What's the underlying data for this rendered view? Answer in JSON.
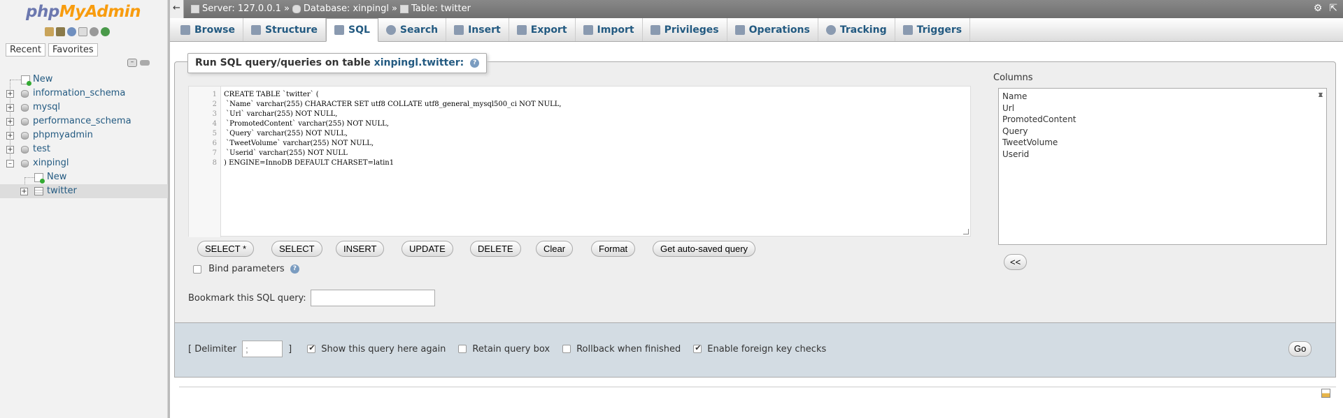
{
  "sidebar": {
    "logo": {
      "php": "php",
      "my": "My",
      "admin": "Admin"
    },
    "tabs": {
      "recent": "Recent",
      "favorites": "Favorites"
    },
    "tree": [
      {
        "label": "New",
        "type": "new"
      },
      {
        "label": "information_schema",
        "type": "db"
      },
      {
        "label": "mysql",
        "type": "db"
      },
      {
        "label": "performance_schema",
        "type": "db"
      },
      {
        "label": "phpmyadmin",
        "type": "db"
      },
      {
        "label": "test",
        "type": "db"
      },
      {
        "label": "xinpingl",
        "type": "db-open"
      }
    ],
    "children": [
      {
        "label": "New"
      },
      {
        "label": "twitter"
      }
    ]
  },
  "topbar": {
    "server": "Server: 127.0.0.1",
    "database": "Database: xinpingl",
    "table": "Table: twitter",
    "sep": "»"
  },
  "tabs": [
    {
      "label": "Browse"
    },
    {
      "label": "Structure"
    },
    {
      "label": "SQL"
    },
    {
      "label": "Search"
    },
    {
      "label": "Insert"
    },
    {
      "label": "Export"
    },
    {
      "label": "Import"
    },
    {
      "label": "Privileges"
    },
    {
      "label": "Operations"
    },
    {
      "label": "Tracking"
    },
    {
      "label": "Triggers"
    }
  ],
  "query": {
    "legend_prefix": "Run SQL query/queries on table",
    "legend_table": "xinpingl.twitter:",
    "help": "?",
    "lines": [
      "CREATE TABLE `twitter` (",
      " `Name` varchar(255) CHARACTER SET utf8 COLLATE utf8_general_mysql500_ci NOT NULL,",
      " `Url` varchar(255) NOT NULL,",
      " `PromotedContent` varchar(255) NOT NULL,",
      " `Query` varchar(255) NOT NULL,",
      " `TweetVolume` varchar(255) NOT NULL,",
      " `Userid` varchar(255) NOT NULL",
      ") ENGINE=InnoDB DEFAULT CHARSET=latin1"
    ],
    "buttons": {
      "select_star": "SELECT *",
      "select": "SELECT",
      "insert": "INSERT",
      "update": "UPDATE",
      "delete": "DELETE",
      "clear": "Clear",
      "format": "Format",
      "autosaved": "Get auto-saved query"
    },
    "bind_parameters": "Bind parameters",
    "bookmark_label": "Bookmark this SQL query:",
    "bookmark_value": ""
  },
  "columns": {
    "label": "Columns",
    "items": [
      "Name",
      "Url",
      "PromotedContent",
      "Query",
      "TweetVolume",
      "Userid"
    ],
    "insert_btn": "<<"
  },
  "options": {
    "delimiter_open": "[ Delimiter",
    "delimiter_value": ";",
    "delimiter_close": "]",
    "show_query": "Show this query here again",
    "retain": "Retain query box",
    "rollback": "Rollback when finished",
    "foreign_keys": "Enable foreign key checks",
    "go": "Go"
  }
}
